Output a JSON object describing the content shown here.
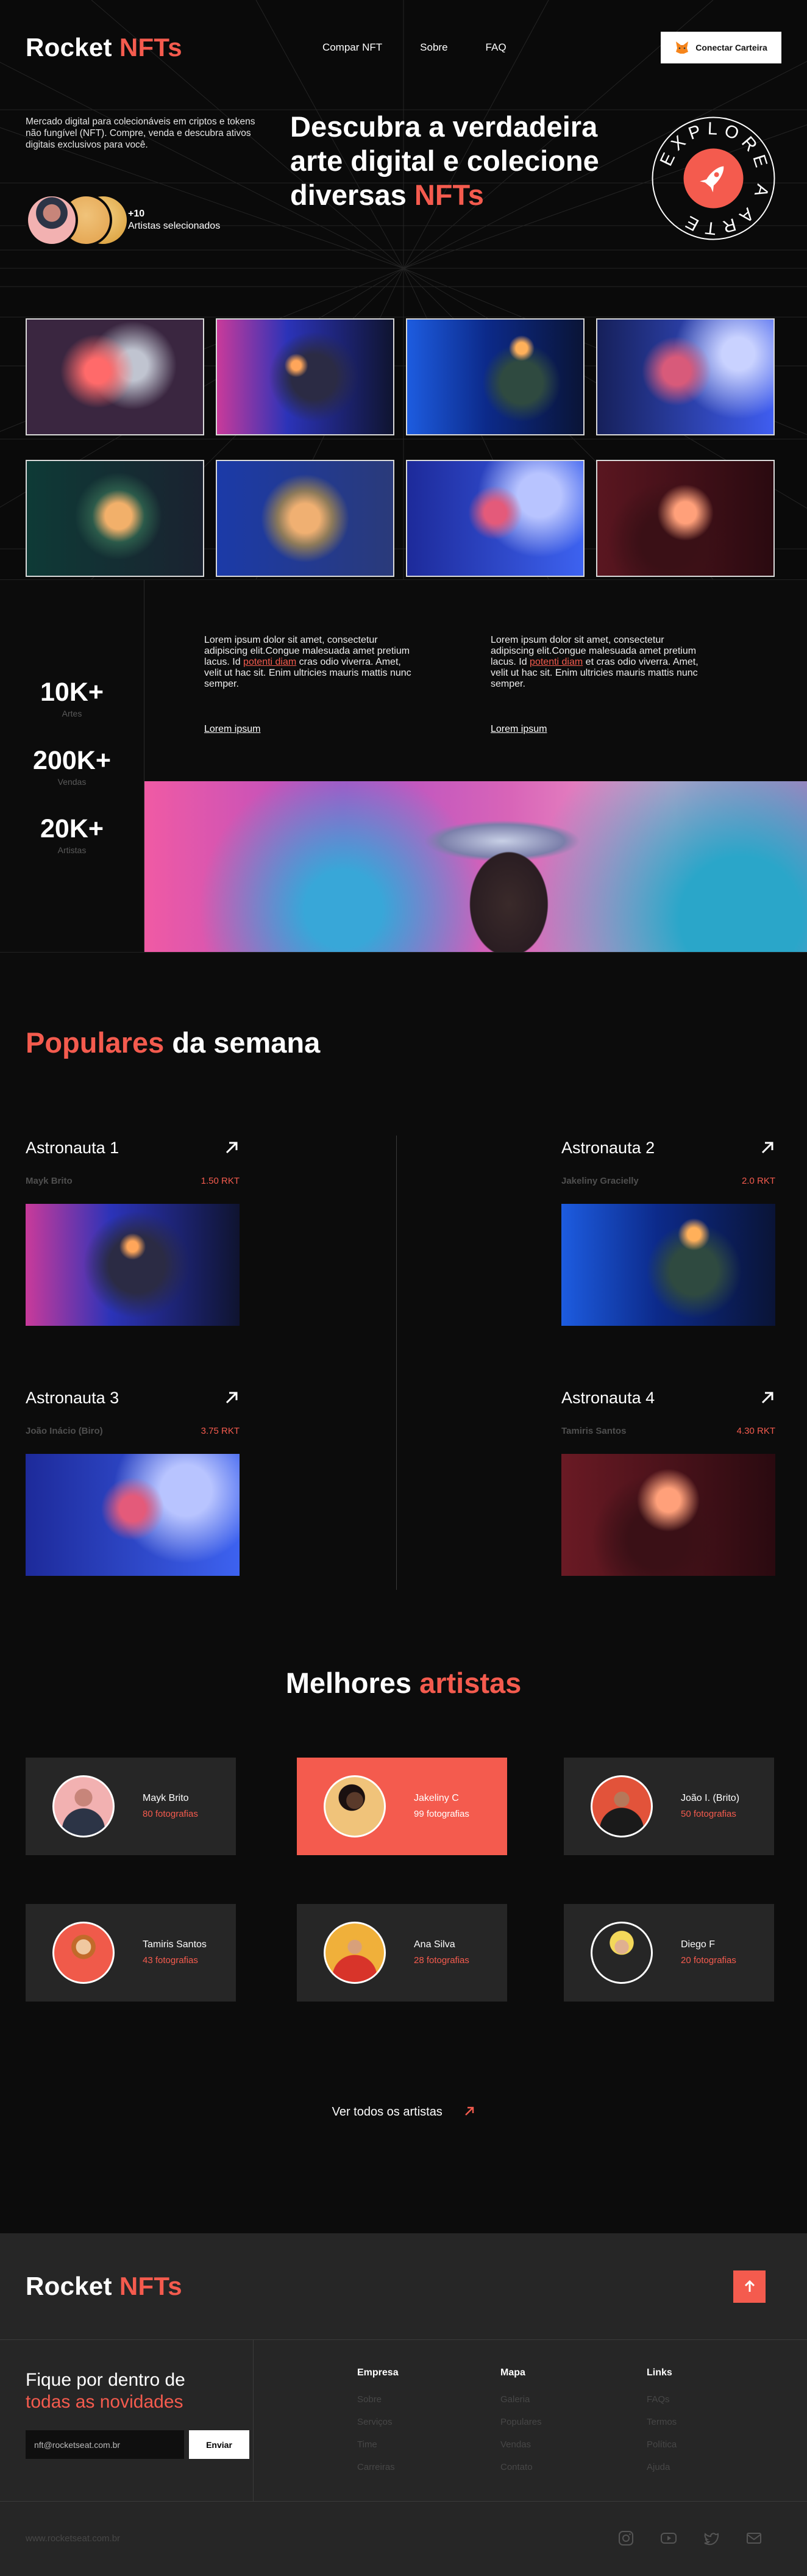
{
  "brand": {
    "logo_main": "Rocket",
    "logo_accent": "NFTs"
  },
  "nav": {
    "items": [
      "Compar NFT",
      "Sobre",
      "FAQ"
    ],
    "wallet_label": "Conectar Carteira"
  },
  "hero": {
    "description": "Mercado digital para colecionáveis em criptos e tokens não fungível (NFT). Compre, venda e descubra ativos digitais exclusivos para você.",
    "artists_count": "+10",
    "artists_label": "Artistas selecionados",
    "title_main": "Descubra a verdadeira arte digital e colecione diversas",
    "title_accent": "NFTs",
    "explore_text": "EXPLORE A ARTE"
  },
  "stats": [
    {
      "value": "10K+",
      "label": "Artes"
    },
    {
      "value": "200K+",
      "label": "Vendas"
    },
    {
      "value": "20K+",
      "label": "Artistas"
    }
  ],
  "about": [
    {
      "before": "Lorem ipsum dolor sit amet, consectetur adipiscing elit.Congue malesuada amet pretium lacus. Id",
      "highlight": "potenti diam",
      "after": "cras odio viverra. Amet, velit ut hac sit. Enim ultricies mauris mattis nunc semper.",
      "link": "Lorem ipsum"
    },
    {
      "before": "Lorem ipsum dolor sit amet, consectetur adipiscing elit.Congue malesuada amet pretium lacus. Id",
      "highlight": "potenti diam",
      "after": "et cras odio viverra. Amet, velit ut hac sit. Enim ultricies mauris mattis nunc semper.",
      "link": "Lorem ipsum"
    }
  ],
  "popular": {
    "title_accent": "Populares",
    "title_main": "da semana",
    "items": [
      {
        "name": "Astronauta 1",
        "artist": "Mayk Brito",
        "price": "1.50 RKT"
      },
      {
        "name": "Astronauta 2",
        "artist": "Jakeliny Gracielly",
        "price": "2.0 RKT"
      },
      {
        "name": "Astronauta 3",
        "artist": "João Inácio (Biro)",
        "price": "3.75 RKT"
      },
      {
        "name": "Astronauta 4",
        "artist": "Tamiris Santos",
        "price": "4.30 RKT"
      }
    ]
  },
  "artists": {
    "title_main": "Melhores",
    "title_accent": "artistas",
    "items": [
      {
        "name": "Mayk Brito",
        "count": "80 fotografias"
      },
      {
        "name": "Jakeliny C",
        "count": "99 fotografias"
      },
      {
        "name": "João I. (Brito)",
        "count": "50 fotografias"
      },
      {
        "name": "Tamiris Santos",
        "count": "43 fotografias"
      },
      {
        "name": "Ana Silva",
        "count": "28 fotografias"
      },
      {
        "name": "Diego F",
        "count": "20 fotografias"
      }
    ],
    "see_all": "Ver todos os artistas"
  },
  "footer": {
    "news_line1": "Fique por dentro de",
    "news_line2": "todas as novidades",
    "email_value": "nft@rocketseat.com.br",
    "send_label": "Enviar",
    "columns": [
      {
        "title": "Empresa",
        "links": [
          "Sobre",
          "Serviços",
          "Time",
          "Carreiras"
        ]
      },
      {
        "title": "Mapa",
        "links": [
          "Galeria",
          "Populares",
          "Vendas",
          "Contato"
        ]
      },
      {
        "title": "Links",
        "links": [
          "FAQs",
          "Termos",
          "Política",
          "Ajuda"
        ]
      }
    ],
    "site": "www.rocketseat.com.br"
  },
  "colors": {
    "accent": "#f45b4e",
    "background": "#0c0c0c",
    "card": "#262626"
  }
}
